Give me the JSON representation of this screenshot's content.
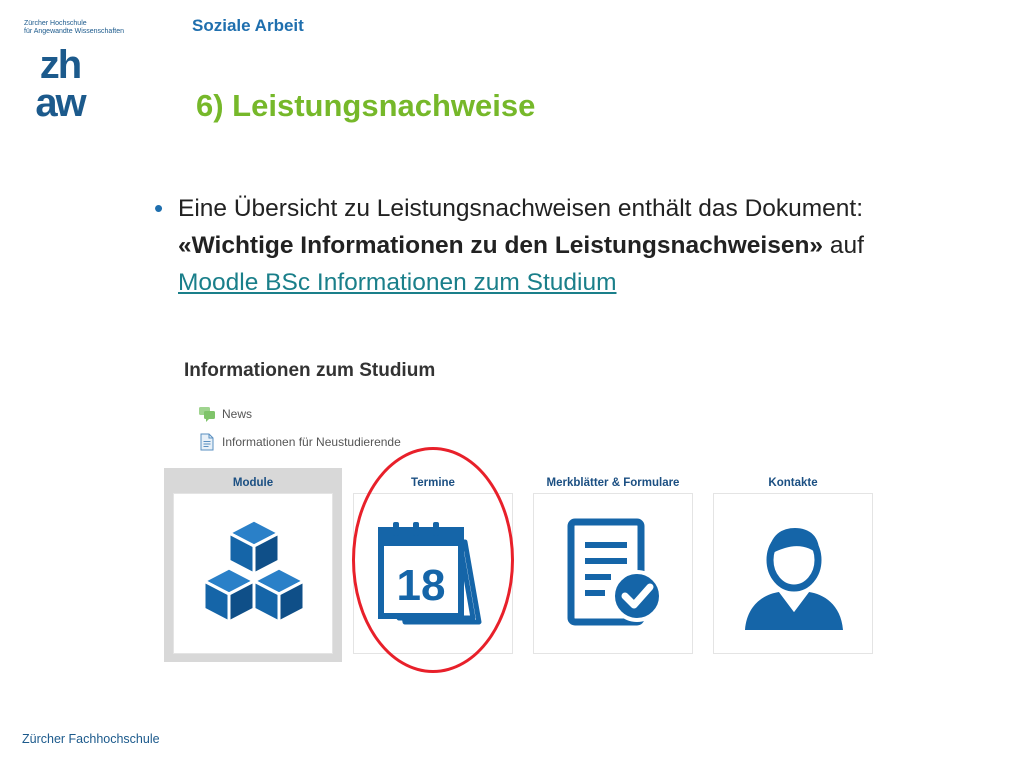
{
  "header": {
    "institution_line1": "Zürcher Hochschule",
    "institution_line2": "für Angewandte Wissenschaften",
    "logo_text": "zhaw",
    "department": "Soziale Arbeit"
  },
  "slide": {
    "title": "6) Leistungsnachweise",
    "bullet_intro": "Eine Übersicht zu Leistungsnachweisen enthält das Dokument:",
    "bullet_bold": "«Wichtige Informationen zu den Leistungsnachweisen»",
    "bullet_after": " auf",
    "bullet_link": "Moodle BSc Informationen zum Studium"
  },
  "moodle": {
    "section_title": "Informationen zum Studium",
    "resources": [
      {
        "label": "News",
        "icon": "forum-icon"
      },
      {
        "label": "Informationen für Neustudierende",
        "icon": "document-icon"
      }
    ],
    "tiles": [
      {
        "label": "Module",
        "icon": "cubes-icon"
      },
      {
        "label": "Termine",
        "icon": "calendar-icon",
        "day": "18"
      },
      {
        "label": "Merkblätter & Formulare",
        "icon": "form-check-icon"
      },
      {
        "label": "Kontakte",
        "icon": "person-icon"
      }
    ],
    "highlighted_tile": "Termine"
  },
  "colors": {
    "brand_blue": "#1f6fae",
    "title_green": "#76b82a",
    "link_teal": "#1a7f8a",
    "icon_blue": "#1565a8",
    "highlight_red": "#e8202a"
  },
  "footer": {
    "text": "Zürcher Fachhochschule"
  }
}
